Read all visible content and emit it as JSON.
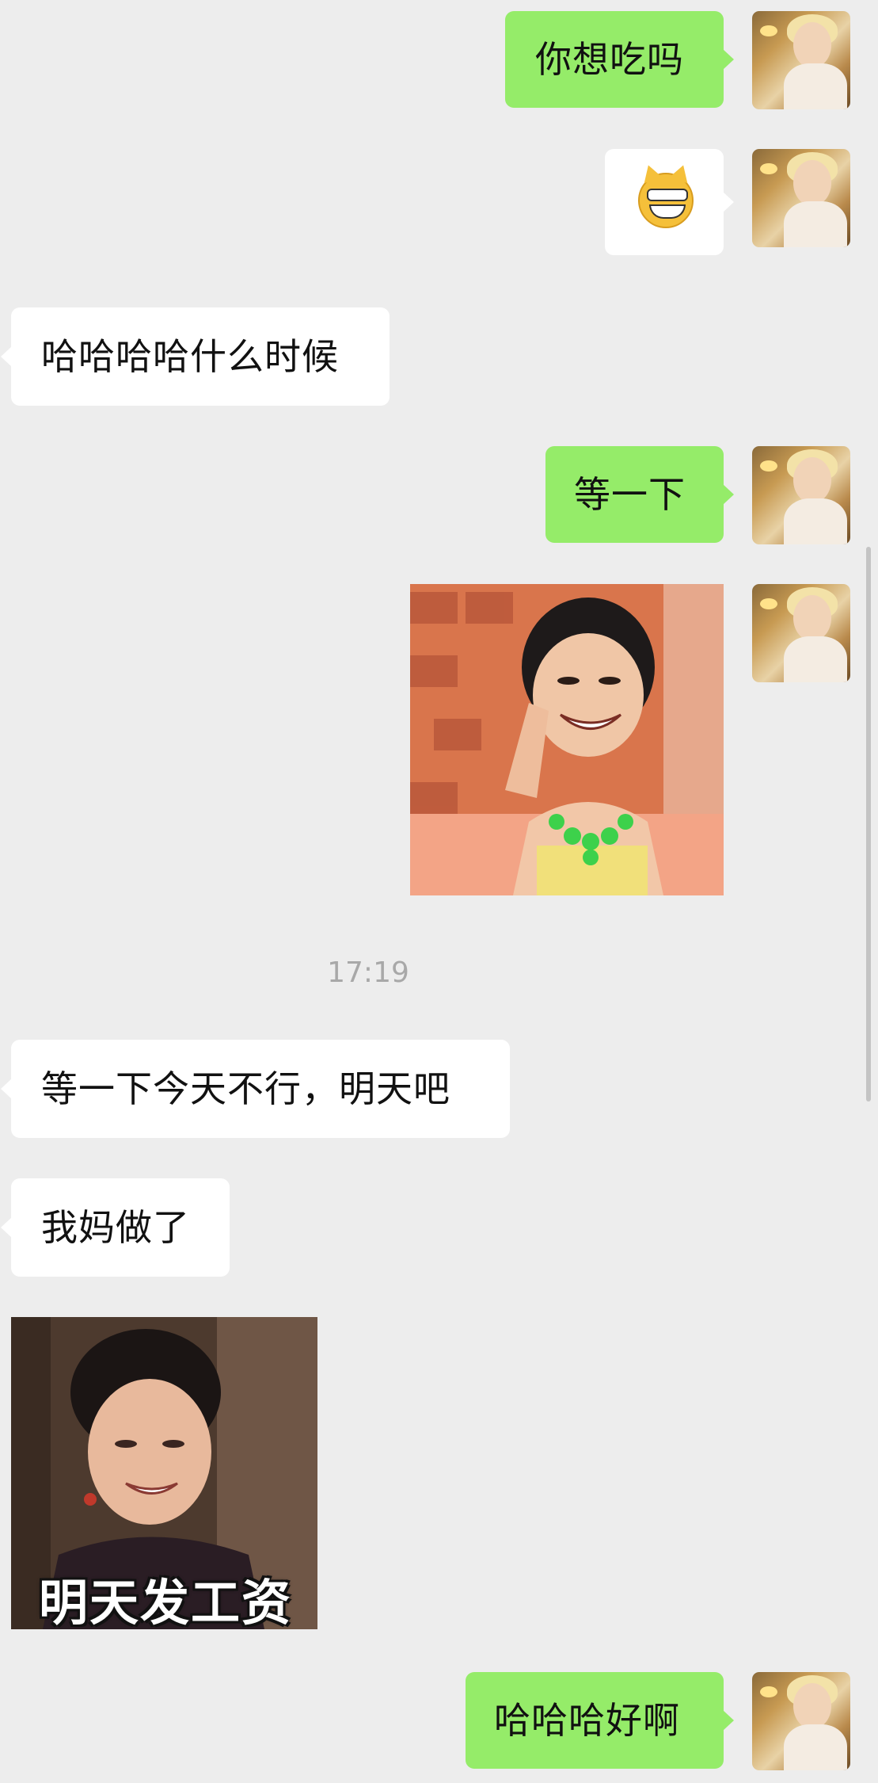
{
  "messages": {
    "m1": {
      "text": "你想吃吗"
    },
    "m2": {
      "emoji": "grinning-cat-emoji"
    },
    "m3": {
      "text": "哈哈哈哈什么时候"
    },
    "m4": {
      "text": "等一下"
    },
    "m5": {
      "image": "woman-laughing-finger-on-nose-sticker"
    },
    "timestamp": "17:19",
    "m6": {
      "text": "等一下今天不行，明天吧"
    },
    "m7": {
      "text": "我妈做了"
    },
    "m8": {
      "image": "smiling-woman-meme",
      "caption": "明天发工资"
    },
    "m9": {
      "text": "哈哈哈好啊"
    }
  },
  "colors": {
    "background": "#ededed",
    "outgoing_bubble": "#95ec69",
    "incoming_bubble": "#ffffff",
    "timestamp_text": "#a8a8a8"
  }
}
